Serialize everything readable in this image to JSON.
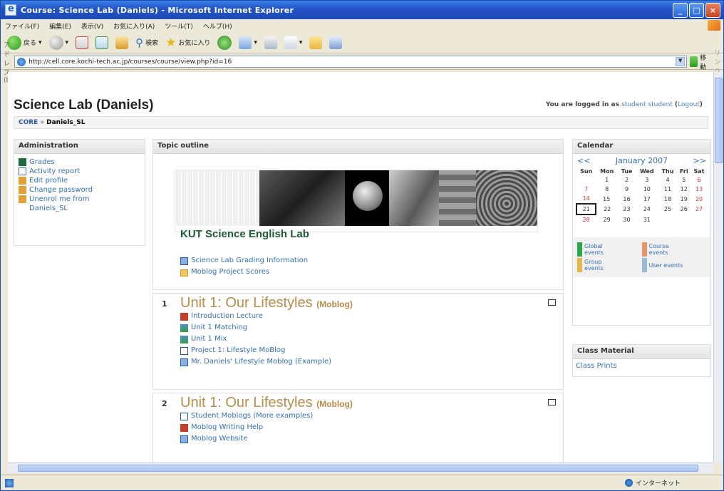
{
  "window": {
    "title": "Course: Science Lab (Daniels) - Microsoft Internet Explorer",
    "buttons": {
      "min": "_",
      "max": "□",
      "close": "×"
    }
  },
  "menu": [
    "ファイル(F)",
    "編集(E)",
    "表示(V)",
    "お気に入り(A)",
    "ツール(T)",
    "ヘルプ(H)"
  ],
  "toolbar": {
    "back": "戻る",
    "search": "検索",
    "favorites": "お気に入り"
  },
  "address": {
    "label": "アドレス(D)",
    "url": "http://cell.core.kochi-tech.ac.jp/courses/course/view.php?id=16",
    "go": "移動",
    "links": "リンク"
  },
  "page": {
    "title": "Science Lab (Daniels)",
    "login_prefix": "You are logged in as ",
    "login_user": "student student",
    "logout": "Logout",
    "breadcrumb_root": "CORE",
    "breadcrumb_sep": "»",
    "breadcrumb_course": "Daniels_SL"
  },
  "admin": {
    "heading": "Administration",
    "items": [
      {
        "label": "Grades",
        "icon": "grades-icon"
      },
      {
        "label": "Activity report",
        "icon": "report-icon"
      },
      {
        "label": "Edit profile",
        "icon": "edit-profile-icon"
      },
      {
        "label": "Change password",
        "icon": "password-icon"
      },
      {
        "label": "Unenrol me from Daniels_SL",
        "icon": "unenrol-icon"
      }
    ]
  },
  "topic": {
    "heading": "Topic outline",
    "banner_title": "KUT Science English Lab",
    "links": [
      {
        "label": "Science Lab Grading Information",
        "icon": "document-icon"
      },
      {
        "label": "Moblog Project Scores",
        "icon": "folder-icon"
      }
    ],
    "units": [
      {
        "num": "1",
        "title": "Unit 1: Our Lifestyles",
        "tag": "(Moblog)",
        "items": [
          {
            "label": "Introduction Lecture",
            "icon": "lecture-icon"
          },
          {
            "label": "Unit 1 Matching",
            "icon": "quiz-icon"
          },
          {
            "label": "Unit 1 Mix",
            "icon": "quiz-icon"
          },
          {
            "label": "Project 1: Lifestyle MoBlog",
            "icon": "document-icon"
          },
          {
            "label": "Mr. Daniels' Lifestyle Moblog (Example)",
            "icon": "document-icon"
          }
        ]
      },
      {
        "num": "2",
        "title": "Unit 1: Our Lifestyles",
        "tag": "(Moblog)",
        "items": [
          {
            "label": "Student Moblogs (More examples)",
            "icon": "document-icon"
          },
          {
            "label": "Moblog Writing Help",
            "icon": "lecture-icon"
          },
          {
            "label": "Moblog Website",
            "icon": "document-icon"
          }
        ]
      }
    ]
  },
  "calendar": {
    "heading": "Calendar",
    "prev": "<<",
    "next": ">>",
    "month": "January 2007",
    "days": [
      "Sun",
      "Mon",
      "Tue",
      "Wed",
      "Thu",
      "Fri",
      "Sat"
    ],
    "weeks": [
      [
        "",
        "1",
        "2",
        "3",
        "4",
        "5",
        "6"
      ],
      [
        "7",
        "8",
        "9",
        "10",
        "11",
        "12",
        "13"
      ],
      [
        "14",
        "15",
        "16",
        "17",
        "18",
        "19",
        "20"
      ],
      [
        "21",
        "22",
        "23",
        "24",
        "25",
        "26",
        "27"
      ],
      [
        "28",
        "29",
        "30",
        "31",
        "",
        "",
        ""
      ]
    ],
    "today": "21",
    "legend": [
      {
        "label": "Global events",
        "color": "#2aa84a"
      },
      {
        "label": "Course events",
        "color": "#e8946a"
      },
      {
        "label": "Group events",
        "color": "#e6b74a"
      },
      {
        "label": "User events",
        "color": "#9ab8d4"
      }
    ]
  },
  "class_material": {
    "heading": "Class Material",
    "link": "Class Prints"
  },
  "status": {
    "zone": "インターネット"
  }
}
